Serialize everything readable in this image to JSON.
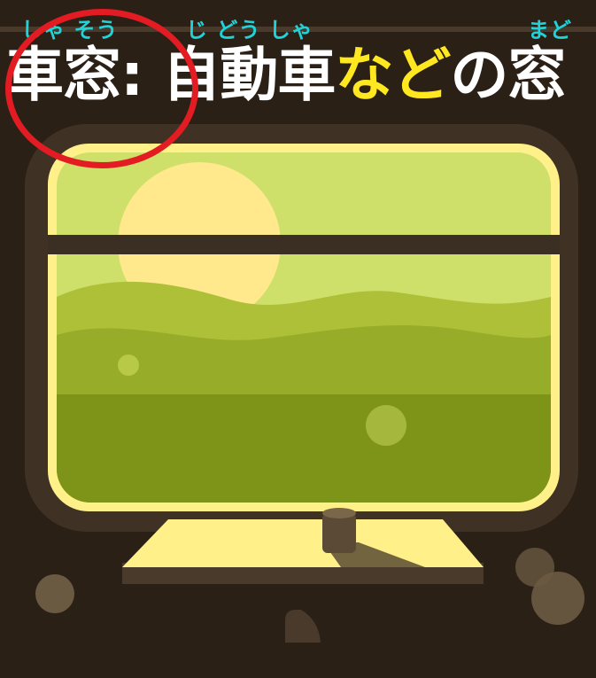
{
  "ruby": {
    "shasou": "しゃ そう",
    "jidousha": "じ どう しゃ",
    "nado": "まど"
  },
  "title": {
    "part1": "車窓: 自動車",
    "part2": "など",
    "part3": "の窓"
  },
  "colors": {
    "background": "#2b2016",
    "ruby": "#1fd3d8",
    "highlight": "#ffe81f",
    "title_text": "#ffffff",
    "circle": "#e31b23",
    "window_frame": "#fff08a",
    "sky": "#cfe06a",
    "sun": "#ffe98c",
    "hills": "#97ac28",
    "ground": "#7d9419"
  }
}
